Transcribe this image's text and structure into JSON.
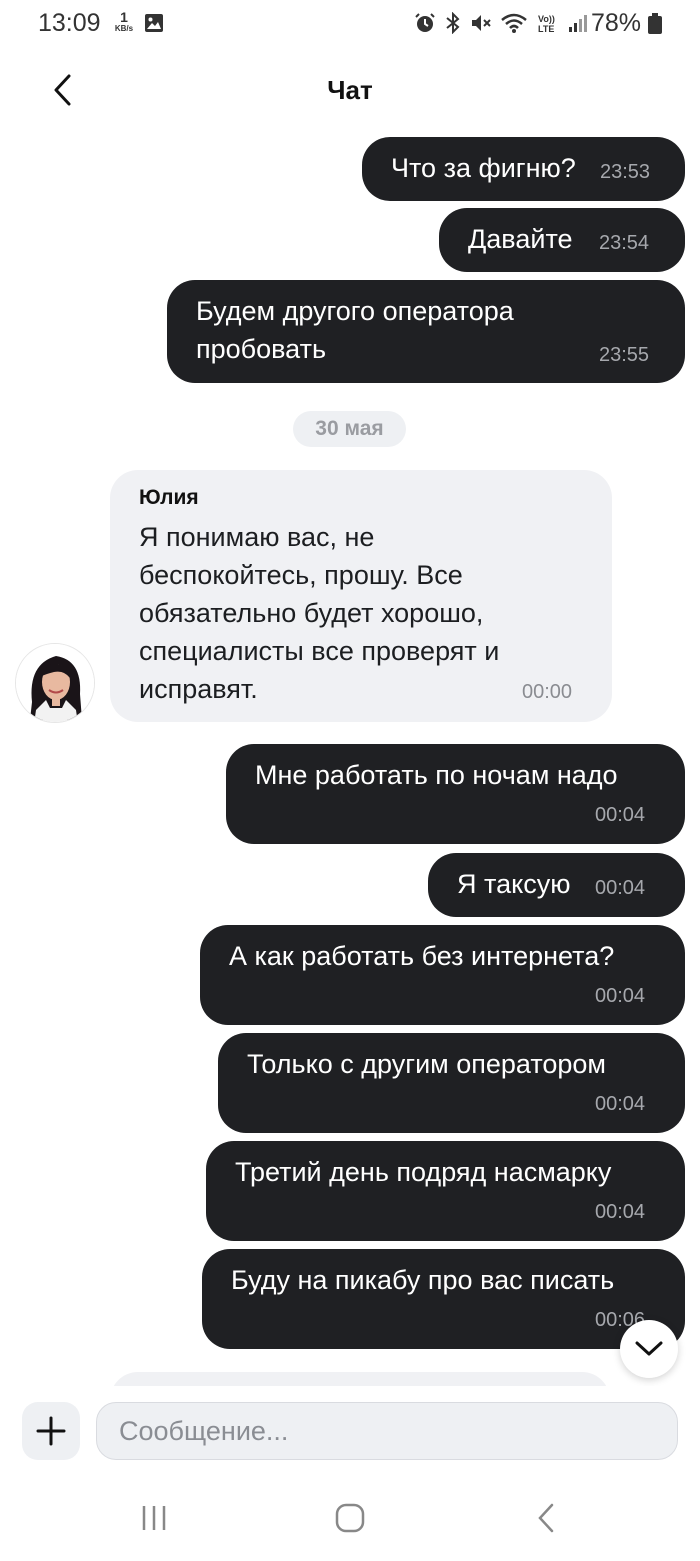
{
  "status_bar": {
    "time": "13:09",
    "net_speed_value": "1",
    "net_speed_unit": "KB/s",
    "battery_percent": "78%",
    "icons": [
      "image-icon",
      "alarm-icon",
      "bluetooth-icon",
      "mute-icon",
      "wifi-icon",
      "volte-icon",
      "signal-icon",
      "battery-icon"
    ]
  },
  "header": {
    "title": "Чат",
    "back_icon": "chevron-left-icon"
  },
  "messages": [
    {
      "dir": "out",
      "text": "Что за фигню?",
      "time": "23:53"
    },
    {
      "dir": "out",
      "text": "Давайте",
      "time": "23:54"
    },
    {
      "dir": "out",
      "text": "Будем другого оператора\nпробовать",
      "time": "23:55"
    },
    {
      "dir": "date",
      "text": "30 мая"
    },
    {
      "dir": "in",
      "sender": "Юлия",
      "text": "Я понимаю вас, не\nбеспокойтесь, прошу. Все\nобязательно будет хорошо,\nспециалисты все проверят и\nисправят.",
      "time": "00:00"
    },
    {
      "dir": "out",
      "text": "Мне работать по ночам надо",
      "time": "00:04"
    },
    {
      "dir": "out",
      "text": "Я таксую",
      "time": "00:04"
    },
    {
      "dir": "out",
      "text": "А как работать без интернета?",
      "time": "00:04"
    },
    {
      "dir": "out",
      "text": "Только с другим оператором",
      "time": "00:04"
    },
    {
      "dir": "out",
      "text": "Третий день подряд насмарку",
      "time": "00:04"
    },
    {
      "dir": "out",
      "text": "Буду на пикабу про вас писать",
      "time": "00:06"
    }
  ],
  "composer": {
    "placeholder": "Сообщение...",
    "add_icon": "plus-icon"
  },
  "colors": {
    "outgoing_bubble": "#1f2023",
    "incoming_bubble": "#f0f1f4",
    "background": "#ffffff"
  }
}
